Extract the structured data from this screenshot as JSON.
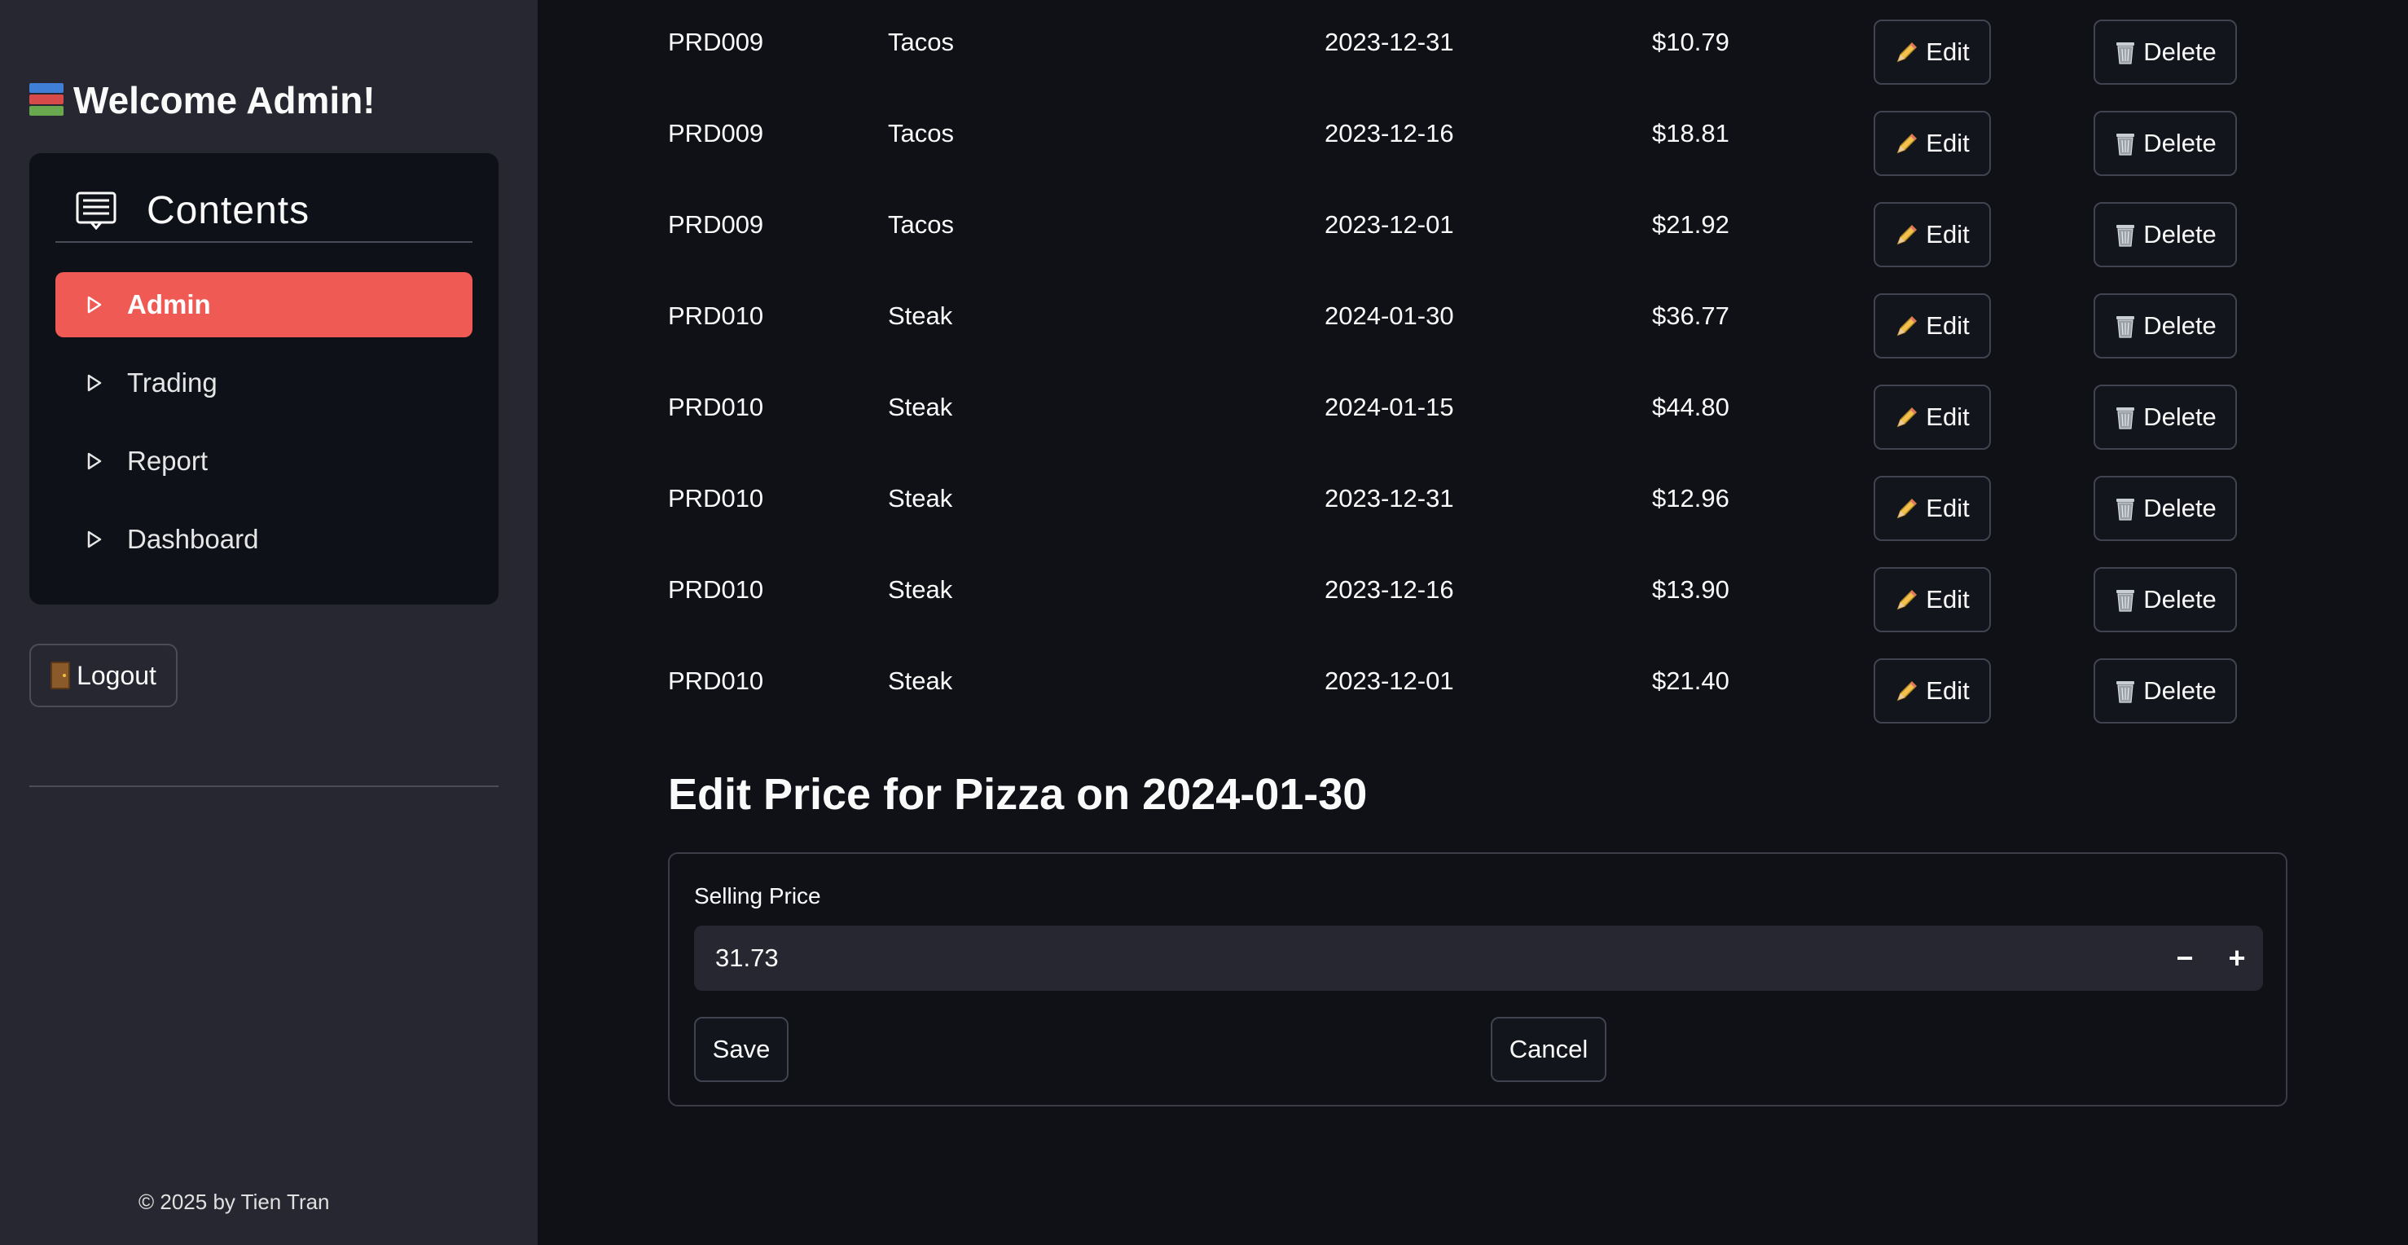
{
  "sidebar": {
    "welcome": "Welcome Admin!",
    "menu_title": "Contents",
    "items": [
      {
        "label": "Admin",
        "active": true
      },
      {
        "label": "Trading",
        "active": false
      },
      {
        "label": "Report",
        "active": false
      },
      {
        "label": "Dashboard",
        "active": false
      }
    ],
    "logout_label": "Logout",
    "footer": "© 2025 by Tien Tran"
  },
  "table": {
    "edit_label": "Edit",
    "delete_label": "Delete",
    "rows": [
      {
        "code": "PRD009",
        "name": "Tacos",
        "date": "2023-12-31",
        "price": "$10.79"
      },
      {
        "code": "PRD009",
        "name": "Tacos",
        "date": "2023-12-16",
        "price": "$18.81"
      },
      {
        "code": "PRD009",
        "name": "Tacos",
        "date": "2023-12-01",
        "price": "$21.92"
      },
      {
        "code": "PRD010",
        "name": "Steak",
        "date": "2024-01-30",
        "price": "$36.77"
      },
      {
        "code": "PRD010",
        "name": "Steak",
        "date": "2024-01-15",
        "price": "$44.80"
      },
      {
        "code": "PRD010",
        "name": "Steak",
        "date": "2023-12-31",
        "price": "$12.96"
      },
      {
        "code": "PRD010",
        "name": "Steak",
        "date": "2023-12-16",
        "price": "$13.90"
      },
      {
        "code": "PRD010",
        "name": "Steak",
        "date": "2023-12-01",
        "price": "$21.40"
      }
    ]
  },
  "edit_form": {
    "title": "Edit Price for Pizza on 2024-01-30",
    "field_label": "Selling Price",
    "value": "31.73",
    "minus": "−",
    "plus": "+",
    "save_label": "Save",
    "cancel_label": "Cancel"
  },
  "colors": {
    "accent": "#ef5b54",
    "sidebar_bg": "#262730",
    "main_bg": "#0f1117"
  }
}
